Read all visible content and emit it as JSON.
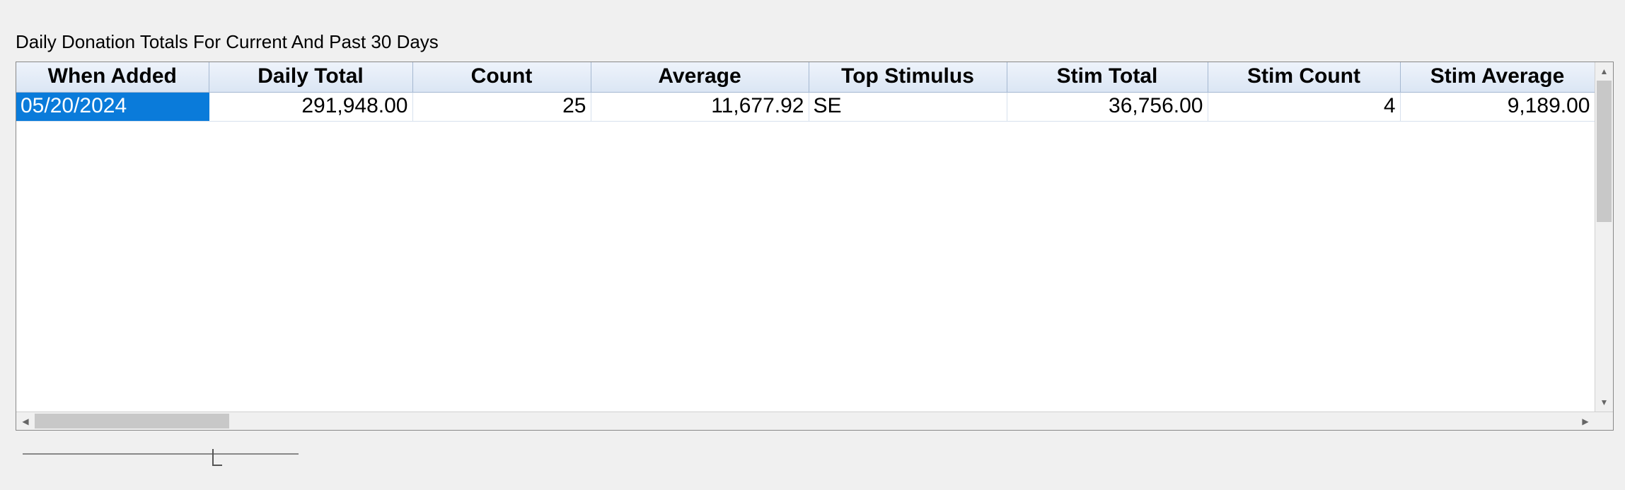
{
  "title": "Daily Donation Totals For Current And Past 30 Days",
  "columns": {
    "when_added": "When Added",
    "daily_total": "Daily Total",
    "count": "Count",
    "average": "Average",
    "top_stimulus": "Top Stimulus",
    "stim_total": "Stim Total",
    "stim_count": "Stim Count",
    "stim_average": "Stim Average"
  },
  "rows": [
    {
      "when_added": "05/20/2024",
      "daily_total": "291,948.00",
      "count": "25",
      "average": "11,677.92",
      "top_stimulus": "SE",
      "stim_total": "36,756.00",
      "stim_count": "4",
      "stim_average": "9,189.00"
    }
  ]
}
